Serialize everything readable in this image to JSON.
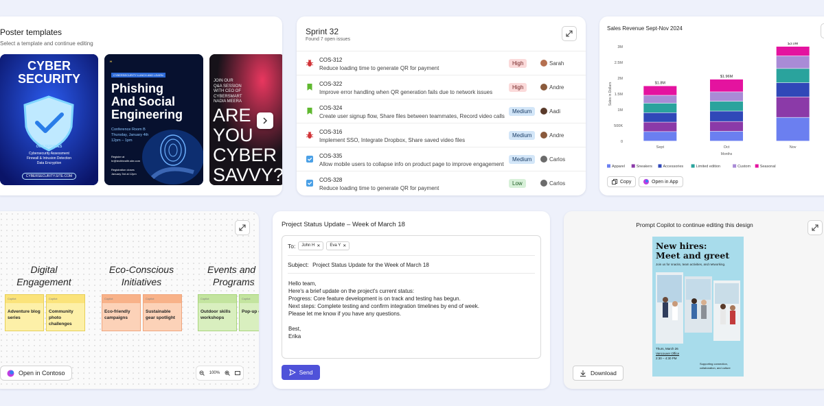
{
  "posters_card": {
    "title": "Poster templates",
    "subtitle": "Select a template and continue editing",
    "poster1": {
      "heading_line1": "CYBER",
      "heading_line2": "SECURITY",
      "services_title": "OUR SERVICES",
      "services": [
        "Cybersecurity Assessment",
        "Firewall & Intrusion Detection",
        "Data Encryption"
      ],
      "url": "CYBERSECURITY.SITE.COM"
    },
    "poster2": {
      "banner": "CYBERSECURITY LUNCH AND LEARN",
      "heading_lines": [
        "Phishing",
        "And Social",
        "Engineering"
      ],
      "details": [
        "Conference Room B",
        "Thursday, January 4th",
        "12pm – 1pm"
      ],
      "register_lines": [
        "Register at",
        "hr@techhealth.site.com"
      ],
      "close_lines": [
        "Registration closes",
        "January 3rd at 12pm"
      ]
    },
    "poster3": {
      "intro_lines": [
        "JOIN OUR",
        "Q&A SESSION",
        "WITH CEO OF",
        "CYBERSMART",
        "NADIA MEERA"
      ],
      "big_lines": [
        "ARE",
        "YOU",
        "CYBER",
        "SAVVY?"
      ]
    }
  },
  "sprint_card": {
    "title": "Sprint 32",
    "subtitle": "Found 7 open issues",
    "issues": [
      {
        "code": "COS-312",
        "desc": "Reduce loading time to generate QR for payment",
        "priority": "High",
        "assignee": "Sarah",
        "type": "bug"
      },
      {
        "code": "COS-322",
        "desc": "Improve error handling when QR generation fails due to network issues",
        "priority": "High",
        "assignee": "Andre",
        "type": "story"
      },
      {
        "code": "COS-324",
        "desc": "Create user signup flow, Share files between teammates, Record video calls",
        "priority": "Medium",
        "assignee": "Aadi",
        "type": "story"
      },
      {
        "code": "COS-316",
        "desc": "Implement SSO, Integrate Dropbox, Share saved video files",
        "priority": "Medium",
        "assignee": "Andre",
        "type": "bug"
      },
      {
        "code": "COS-335",
        "desc": "Allow mobile users to collapse info on product page to improve engagement",
        "priority": "Medium",
        "assignee": "Carlos",
        "type": "task"
      },
      {
        "code": "COS-328",
        "desc": "Reduce loading time to generate QR for payment",
        "priority": "Low",
        "assignee": "Carlos",
        "type": "task"
      }
    ]
  },
  "sales_card": {
    "title": "Sales Revenue Sept-Nov 2024",
    "copy_label": "Copy",
    "open_label": "Open in App"
  },
  "chart_data": {
    "type": "bar",
    "stacked": true,
    "categories": [
      "Sept",
      "Oct",
      "Nov"
    ],
    "totals_labels": [
      "$1.8M",
      "$1.96M",
      "$3.0M"
    ],
    "xlabel": "Months",
    "ylabel": "Sales in Dollars",
    "ylim": [
      0,
      3000000
    ],
    "yticks": [
      "0",
      "500K",
      "1M",
      "1.5M",
      "2M",
      "2.5M",
      "3M"
    ],
    "series": [
      {
        "name": "Apparel",
        "color": "#6b7ff0",
        "values": [
          300000,
          310000,
          750000
        ]
      },
      {
        "name": "Sneakers",
        "color": "#8b3aa8",
        "values": [
          300000,
          310000,
          650000
        ]
      },
      {
        "name": "Accessories",
        "color": "#3048b8",
        "values": [
          300000,
          330000,
          450000
        ]
      },
      {
        "name": "Limited edition",
        "color": "#2aa39d",
        "values": [
          300000,
          310000,
          450000
        ]
      },
      {
        "name": "Custom",
        "color": "#a98bd6",
        "values": [
          250000,
          300000,
          400000
        ]
      },
      {
        "name": "Seasonal",
        "color": "#e4139f",
        "values": [
          300000,
          400000,
          300000
        ]
      }
    ],
    "legend": "bottom",
    "grid": false
  },
  "board_card": {
    "columns": [
      {
        "title_lines": [
          "Digital",
          "Engagement"
        ],
        "notes": [
          "Adventure blog series",
          "Community photo challenges"
        ],
        "color": "yellow"
      },
      {
        "title_lines": [
          "Eco-Conscious",
          "Initiatives"
        ],
        "notes": [
          "Eco-friendly campaigns",
          "Sustainable gear spotlight"
        ],
        "color": "orange"
      },
      {
        "title_lines": [
          "Events and",
          "Programs"
        ],
        "notes": [
          "Outdoor skills workshops",
          "Pop-up events"
        ],
        "color": "green"
      }
    ],
    "note_tag": "Copilot",
    "open_label": "Open in Contoso",
    "zoom": "100%"
  },
  "email_card": {
    "title": "Project Status Update – Week of March 18",
    "to_label": "To:",
    "recipients": [
      "John H",
      "Eva Y"
    ],
    "subject_label": "Subject:",
    "subject": "Project Status Update for the Week of March 18",
    "body_lines": [
      "Hello team,",
      "Here's a brief update on the project's current status:",
      "Progress: Core feature development is on track and testing has begun.",
      "Next steps: Complete testing and confirm integration timelines by end of week.",
      "Please let me know if you have any questions.",
      "",
      "Best,",
      "Erika"
    ],
    "send_label": "Send"
  },
  "copilot_card": {
    "title": "Prompt Copilot to continue editing this design",
    "poster_heading_lines": [
      "New hires:",
      "Meet and greet"
    ],
    "poster_invite": "Join us for snacks, team activities, and networking.",
    "poster_date_lines": [
      "Thurs, March 26",
      "Vancouver Office",
      "2:30 – 4:30 PM"
    ],
    "poster_support_lines": [
      "Supporting connection,",
      "collaboration, and culture"
    ],
    "download_label": "Download"
  }
}
